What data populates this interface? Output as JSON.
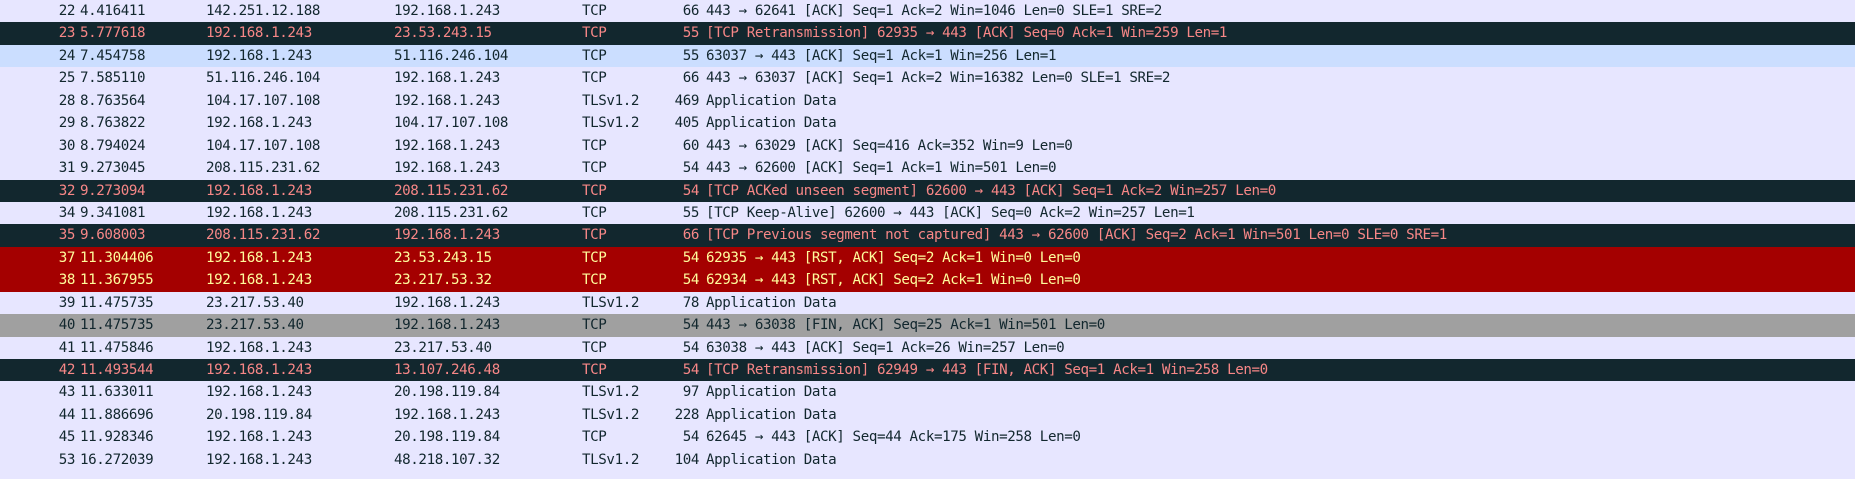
{
  "colors": {
    "default_bg": "#e7e6ff",
    "bad_tcp_bg": "#12272e",
    "bad_tcp_fg": "#f78787",
    "selected_bg": "#cbdeff",
    "rst_bg": "#a40000",
    "rst_fg": "#fffc9c",
    "fin_bg": "#a0a0a0"
  },
  "packets": [
    {
      "no": "22",
      "time": "4.416411",
      "src": "142.251.12.188",
      "dst": "192.168.1.243",
      "proto": "TCP",
      "len": "66",
      "info": "443 → 62641 [ACK] Seq=1 Ack=2 Win=1046 Len=0 SLE=1 SRE=2",
      "style": "normal"
    },
    {
      "no": "23",
      "time": "5.777618",
      "src": "192.168.1.243",
      "dst": "23.53.243.15",
      "proto": "TCP",
      "len": "55",
      "info": "[TCP Retransmission] 62935 → 443 [ACK] Seq=0 Ack=1 Win=259 Len=1",
      "style": "tcp-bad"
    },
    {
      "no": "24",
      "time": "7.454758",
      "src": "192.168.1.243",
      "dst": "51.116.246.104",
      "proto": "TCP",
      "len": "55",
      "info": "63037 → 443 [ACK] Seq=1 Ack=1 Win=256 Len=1",
      "style": "selected"
    },
    {
      "no": "25",
      "time": "7.585110",
      "src": "51.116.246.104",
      "dst": "192.168.1.243",
      "proto": "TCP",
      "len": "66",
      "info": "443 → 63037 [ACK] Seq=1 Ack=2 Win=16382 Len=0 SLE=1 SRE=2",
      "style": "normal"
    },
    {
      "no": "28",
      "time": "8.763564",
      "src": "104.17.107.108",
      "dst": "192.168.1.243",
      "proto": "TLSv1.2",
      "len": "469",
      "info": "Application Data",
      "style": "normal"
    },
    {
      "no": "29",
      "time": "8.763822",
      "src": "192.168.1.243",
      "dst": "104.17.107.108",
      "proto": "TLSv1.2",
      "len": "405",
      "info": "Application Data",
      "style": "normal"
    },
    {
      "no": "30",
      "time": "8.794024",
      "src": "104.17.107.108",
      "dst": "192.168.1.243",
      "proto": "TCP",
      "len": "60",
      "info": "443 → 63029 [ACK] Seq=416 Ack=352 Win=9 Len=0",
      "style": "normal"
    },
    {
      "no": "31",
      "time": "9.273045",
      "src": "208.115.231.62",
      "dst": "192.168.1.243",
      "proto": "TCP",
      "len": "54",
      "info": "443 → 62600 [ACK] Seq=1 Ack=1 Win=501 Len=0",
      "style": "normal"
    },
    {
      "no": "32",
      "time": "9.273094",
      "src": "192.168.1.243",
      "dst": "208.115.231.62",
      "proto": "TCP",
      "len": "54",
      "info": "[TCP ACKed unseen segment] 62600 → 443 [ACK] Seq=1 Ack=2 Win=257 Len=0",
      "style": "tcp-bad"
    },
    {
      "no": "34",
      "time": "9.341081",
      "src": "192.168.1.243",
      "dst": "208.115.231.62",
      "proto": "TCP",
      "len": "55",
      "info": "[TCP Keep-Alive] 62600 → 443 [ACK] Seq=0 Ack=2 Win=257 Len=1",
      "style": "normal"
    },
    {
      "no": "35",
      "time": "9.608003",
      "src": "208.115.231.62",
      "dst": "192.168.1.243",
      "proto": "TCP",
      "len": "66",
      "info": "[TCP Previous segment not captured] 443 → 62600 [ACK] Seq=2 Ack=1 Win=501 Len=0 SLE=0 SRE=1",
      "style": "tcp-bad"
    },
    {
      "no": "37",
      "time": "11.304406",
      "src": "192.168.1.243",
      "dst": "23.53.243.15",
      "proto": "TCP",
      "len": "54",
      "info": "62935 → 443 [RST, ACK] Seq=2 Ack=1 Win=0 Len=0",
      "style": "tcp-rst"
    },
    {
      "no": "38",
      "time": "11.367955",
      "src": "192.168.1.243",
      "dst": "23.217.53.32",
      "proto": "TCP",
      "len": "54",
      "info": "62934 → 443 [RST, ACK] Seq=2 Ack=1 Win=0 Len=0",
      "style": "tcp-rst"
    },
    {
      "no": "39",
      "time": "11.475735",
      "src": "23.217.53.40",
      "dst": "192.168.1.243",
      "proto": "TLSv1.2",
      "len": "78",
      "info": "Application Data",
      "style": "normal"
    },
    {
      "no": "40",
      "time": "11.475735",
      "src": "23.217.53.40",
      "dst": "192.168.1.243",
      "proto": "TCP",
      "len": "54",
      "info": "443 → 63038 [FIN, ACK] Seq=25 Ack=1 Win=501 Len=0",
      "style": "tcp-fin"
    },
    {
      "no": "41",
      "time": "11.475846",
      "src": "192.168.1.243",
      "dst": "23.217.53.40",
      "proto": "TCP",
      "len": "54",
      "info": "63038 → 443 [ACK] Seq=1 Ack=26 Win=257 Len=0",
      "style": "normal"
    },
    {
      "no": "42",
      "time": "11.493544",
      "src": "192.168.1.243",
      "dst": "13.107.246.48",
      "proto": "TCP",
      "len": "54",
      "info": "[TCP Retransmission] 62949 → 443 [FIN, ACK] Seq=1 Ack=1 Win=258 Len=0",
      "style": "tcp-bad"
    },
    {
      "no": "43",
      "time": "11.633011",
      "src": "192.168.1.243",
      "dst": "20.198.119.84",
      "proto": "TLSv1.2",
      "len": "97",
      "info": "Application Data",
      "style": "normal"
    },
    {
      "no": "44",
      "time": "11.886696",
      "src": "20.198.119.84",
      "dst": "192.168.1.243",
      "proto": "TLSv1.2",
      "len": "228",
      "info": "Application Data",
      "style": "normal"
    },
    {
      "no": "45",
      "time": "11.928346",
      "src": "192.168.1.243",
      "dst": "20.198.119.84",
      "proto": "TCP",
      "len": "54",
      "info": "62645 → 443 [ACK] Seq=44 Ack=175 Win=258 Len=0",
      "style": "normal"
    },
    {
      "no": "53",
      "time": "16.272039",
      "src": "192.168.1.243",
      "dst": "48.218.107.32",
      "proto": "TLSv1.2",
      "len": "104",
      "info": "Application Data",
      "style": "normal"
    }
  ]
}
